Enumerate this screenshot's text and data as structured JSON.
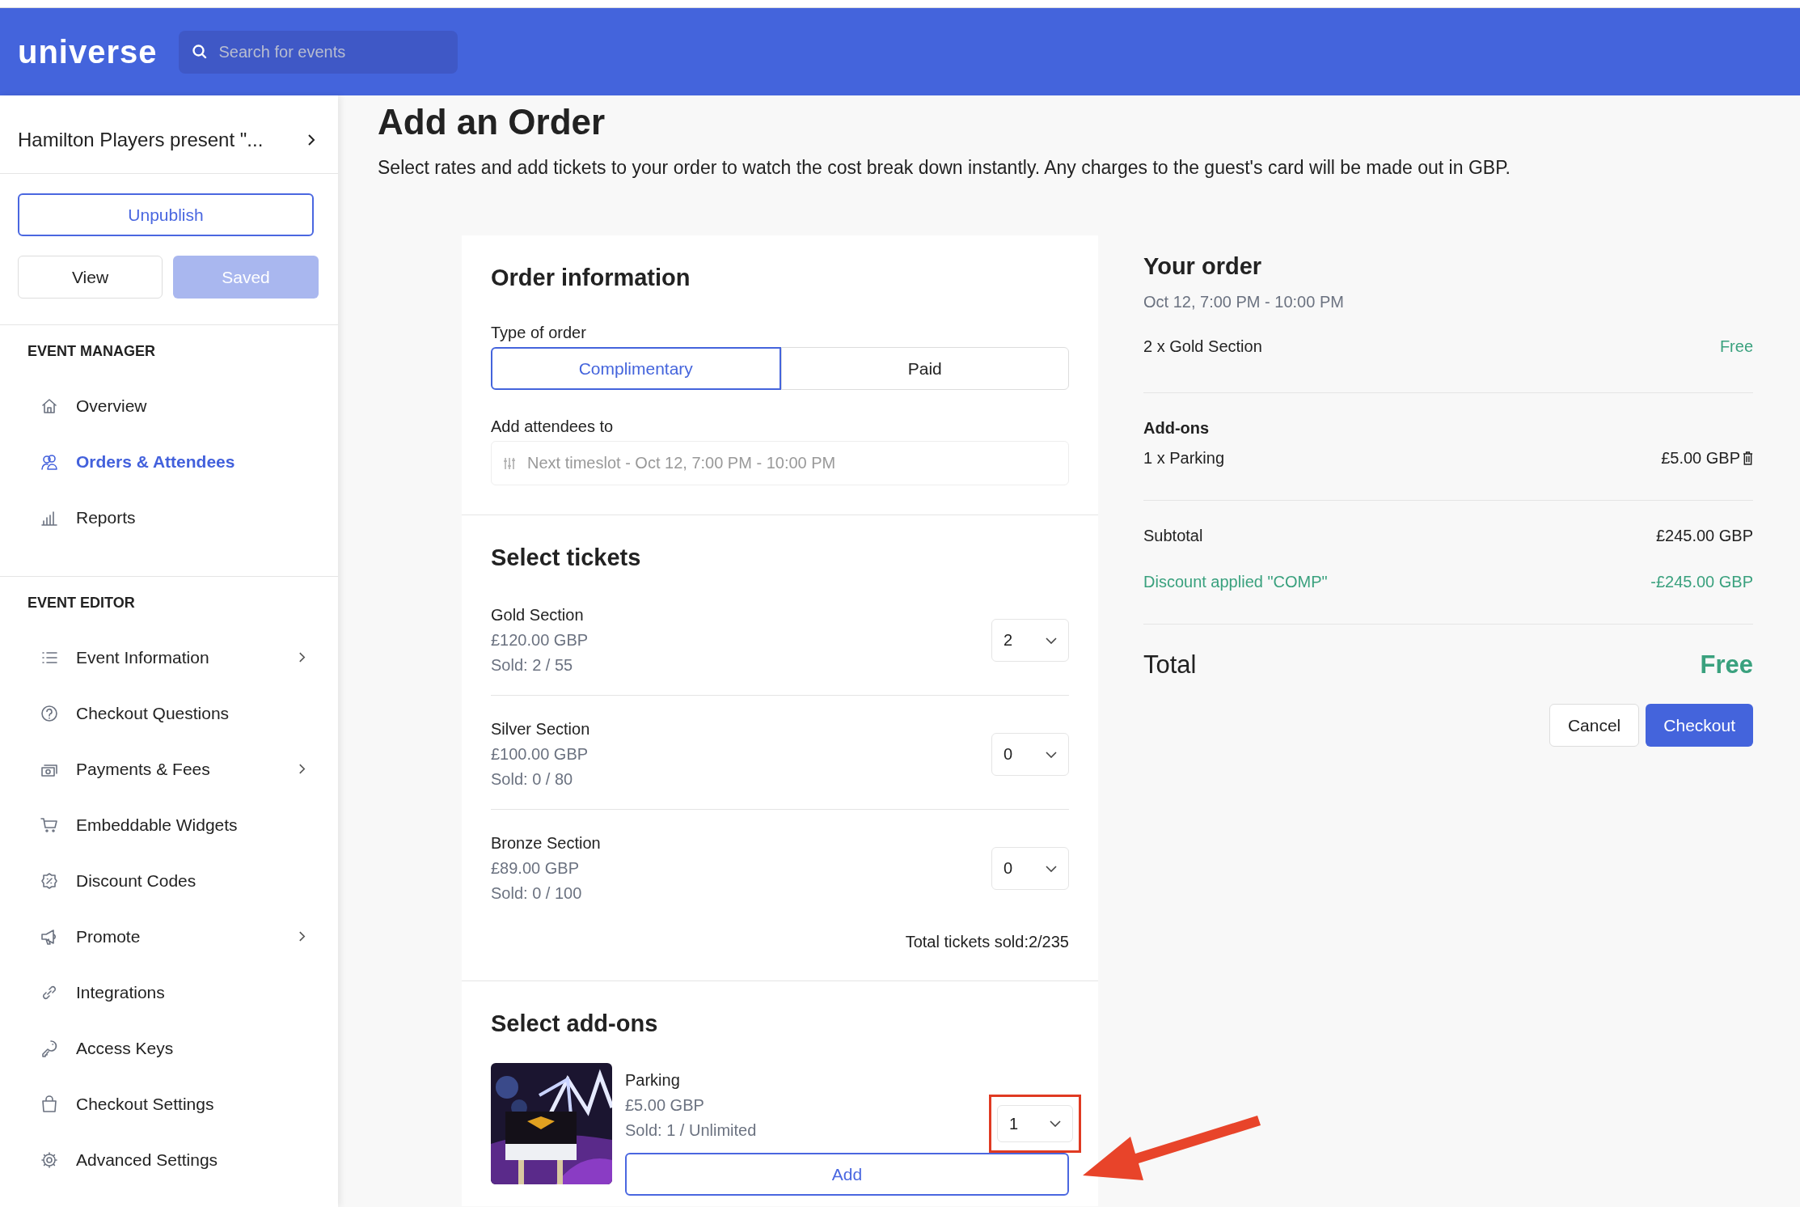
{
  "header": {
    "logo": "universe",
    "search": {
      "placeholder": "Search for events"
    }
  },
  "sidebar": {
    "event_title": "Hamilton Players present \"...",
    "buttons": [
      {
        "label": "Unpublish",
        "kind": "outline"
      },
      {
        "label": "View",
        "kind": "plain"
      },
      {
        "label": "Saved",
        "kind": "disabled"
      }
    ],
    "sections": [
      {
        "heading": "EVENT MANAGER",
        "items": [
          {
            "label": "Overview",
            "selected": false,
            "expandable": false
          },
          {
            "label": "Orders & Attendees",
            "selected": true,
            "expandable": false
          },
          {
            "label": "Reports",
            "selected": false,
            "expandable": false
          }
        ]
      },
      {
        "heading": "EVENT EDITOR",
        "items": [
          {
            "label": "Event Information",
            "selected": false,
            "expandable": true
          },
          {
            "label": "Checkout Questions",
            "selected": false,
            "expandable": false
          },
          {
            "label": "Payments & Fees",
            "selected": false,
            "expandable": true
          },
          {
            "label": "Embeddable Widgets",
            "selected": false,
            "expandable": false
          },
          {
            "label": "Discount Codes",
            "selected": false,
            "expandable": false
          },
          {
            "label": "Promote",
            "selected": false,
            "expandable": true
          },
          {
            "label": "Integrations",
            "selected": false,
            "expandable": false
          },
          {
            "label": "Access Keys",
            "selected": false,
            "expandable": false
          },
          {
            "label": "Checkout Settings",
            "selected": false,
            "expandable": false
          },
          {
            "label": "Advanced Settings",
            "selected": false,
            "expandable": false
          }
        ]
      }
    ]
  },
  "page": {
    "title": "Add an Order",
    "subtitle": "Select rates and add tickets to your order to watch the cost break down instantly. Any charges to the guest's card will be made out in GBP."
  },
  "order_information": {
    "heading": "Order information",
    "type_label": "Type of order",
    "order_types": [
      {
        "label": "Complimentary",
        "selected": true
      },
      {
        "label": "Paid",
        "selected": false
      }
    ],
    "attendees_label": "Add attendees to",
    "timeslot": {
      "value": "Next timeslot - Oct 12, 7:00 PM - 10:00 PM",
      "disabled": true
    }
  },
  "tickets": {
    "heading": "Select tickets",
    "items": [
      {
        "name": "Gold Section",
        "price": "£120.00 GBP",
        "sold": "Sold: 2 / 55",
        "quantity": "2"
      },
      {
        "name": "Silver Section",
        "price": "£100.00 GBP",
        "sold": "Sold: 0 / 80",
        "quantity": "0"
      },
      {
        "name": "Bronze Section",
        "price": "£89.00 GBP",
        "sold": "Sold: 0 / 100",
        "quantity": "0"
      }
    ],
    "total_sold": "Total tickets sold:2/235"
  },
  "addons": {
    "heading": "Select add-ons",
    "items": [
      {
        "kind": "picture",
        "name": "Parking",
        "price": "£5.00 GBP",
        "sold": "Sold: 1 / Unlimited",
        "quantity": "1",
        "highlighted": true,
        "button": "Add"
      }
    ]
  },
  "your_order": {
    "heading": "Your order",
    "date": "Oct 12, 7:00 PM - 10:00 PM",
    "ticket_lines": [
      {
        "label": "2 x Gold Section",
        "amount": "Free",
        "kind": "free"
      }
    ],
    "addons_heading": "Add-ons",
    "addon_lines": [
      {
        "label": "1 x Parking",
        "amount": "£5.00 GBP",
        "removable": true
      }
    ],
    "subtotal": {
      "label": "Subtotal",
      "amount": "£245.00 GBP"
    },
    "discount": {
      "label": "Discount applied \"COMP\"",
      "amount": "-£245.00 GBP"
    },
    "total": {
      "label": "Total",
      "amount": "Free",
      "kind": "free"
    },
    "buttons": [
      {
        "label": "Cancel",
        "kind": "secondary"
      },
      {
        "label": "Checkout",
        "kind": "primary"
      }
    ]
  }
}
